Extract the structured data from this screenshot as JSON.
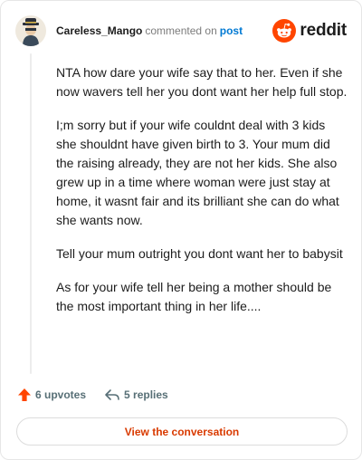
{
  "header": {
    "author": "Careless_Mango",
    "meta_text": "commented on",
    "post_link": "post",
    "brand": "reddit"
  },
  "comment": {
    "paragraphs": [
      "NTA how dare your wife say that to her. Even if she now wavers tell her you dont want her help full stop.",
      "I;m sorry but if your wife couldnt deal with 3 kids she shouldnt have given birth to 3. Your mum did the raising already, they are not her kids. She also grew up in a time where woman were just stay at home, it wasnt fair and its brilliant she can do what she wants now.",
      "Tell your mum outright you dont want her to babysit",
      "As for your wife tell her being a mother should be the most important thing in her life...."
    ]
  },
  "actions": {
    "upvotes": "6 upvotes",
    "replies": "5 replies"
  },
  "view_button": "View the conversation",
  "colors": {
    "brand_orange": "#ff4500",
    "link_blue": "#0079d3",
    "button_text": "#d93a00"
  }
}
